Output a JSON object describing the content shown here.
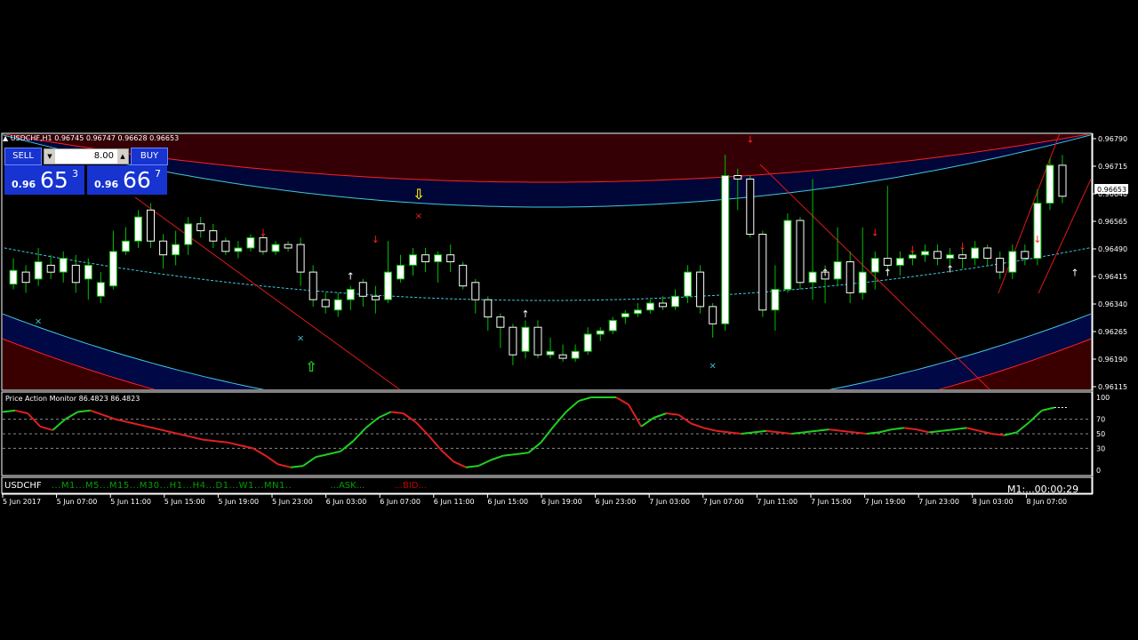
{
  "chart_header": {
    "symbol": "USDCHF,H1",
    "ohlc": "0.96745 0.96747 0.96628 0.96653"
  },
  "trade_panel": {
    "sell_label": "SELL",
    "buy_label": "BUY",
    "lot_value": "8.00",
    "sell_prefix": "0.96",
    "sell_big": "65",
    "sell_sup": "3",
    "buy_prefix": "0.96",
    "buy_big": "66",
    "buy_sup": "7"
  },
  "oscillator": {
    "title": "Price Action Monitor 86.4823 86.4823"
  },
  "bottom_bar": {
    "symbol": "USDCHF",
    "timeframes": "...M1...M5...M15...M30...H1...H4...D1...W1...MN1..",
    "ask": "...ASK...",
    "bid": "...BID...",
    "timer": "M1:...00:00:29"
  },
  "colors": {
    "background": "#000000",
    "up_candle": "#ffffff",
    "wick": "#00c000",
    "band_red": "#ff2020",
    "band_cyan": "#40c8e0",
    "osc_up": "#20d020",
    "osc_down": "#e02020",
    "osc_neutral": "#ffffff"
  },
  "chart_data": [
    {
      "type": "candlestick",
      "title": "USDCHF,H1",
      "ylim": [
        0.9608,
        0.9682
      ],
      "y_ticks": [
        "0.96790",
        "0.96715",
        "0.96640",
        "0.96565",
        "0.96490",
        "0.96415",
        "0.96340",
        "0.96265",
        "0.96190",
        "0.96115"
      ],
      "current_price_label": "0.96653",
      "x_ticks": [
        "5 Jun 2017",
        "5 Jun 07:00",
        "5 Jun 11:00",
        "5 Jun 15:00",
        "5 Jun 19:00",
        "5 Jun 23:00",
        "6 Jun 03:00",
        "6 Jun 07:00",
        "6 Jun 11:00",
        "6 Jun 15:00",
        "6 Jun 19:00",
        "6 Jun 23:00",
        "7 Jun 03:00",
        "7 Jun 07:00",
        "7 Jun 11:00",
        "7 Jun 15:00",
        "7 Jun 19:00",
        "7 Jun 23:00",
        "8 Jun 03:00",
        "8 Jun 07:00"
      ],
      "candles": [
        [
          0.96385,
          0.96425,
          0.9646,
          0.9637
        ],
        [
          0.9642,
          0.9639,
          0.9644,
          0.9636
        ],
        [
          0.964,
          0.9645,
          0.9649,
          0.9638
        ],
        [
          0.9644,
          0.9642,
          0.9647,
          0.964
        ],
        [
          0.9642,
          0.9646,
          0.9648,
          0.9639
        ],
        [
          0.9644,
          0.9639,
          0.9647,
          0.9636
        ],
        [
          0.964,
          0.9644,
          0.9646,
          0.9634
        ],
        [
          0.9635,
          0.9639,
          0.9642,
          0.9633
        ],
        [
          0.9638,
          0.9648,
          0.9654,
          0.9637
        ],
        [
          0.9648,
          0.9651,
          0.9655,
          0.9647
        ],
        [
          0.9651,
          0.9658,
          0.966,
          0.9649
        ],
        [
          0.966,
          0.9651,
          0.9662,
          0.9649
        ],
        [
          0.9651,
          0.9647,
          0.9653,
          0.9643
        ],
        [
          0.9647,
          0.965,
          0.9654,
          0.9644
        ],
        [
          0.965,
          0.9656,
          0.9658,
          0.9647
        ],
        [
          0.9656,
          0.9654,
          0.9658,
          0.9652
        ],
        [
          0.9654,
          0.9651,
          0.9656,
          0.9649
        ],
        [
          0.9651,
          0.9648,
          0.9652,
          0.9647
        ],
        [
          0.9648,
          0.9649,
          0.9651,
          0.9646
        ],
        [
          0.9649,
          0.9652,
          0.9653,
          0.9648
        ],
        [
          0.9652,
          0.9648,
          0.9653,
          0.9647
        ],
        [
          0.9648,
          0.965,
          0.9651,
          0.9647
        ],
        [
          0.965,
          0.9649,
          0.9651,
          0.9648
        ],
        [
          0.965,
          0.9642,
          0.9652,
          0.9638
        ],
        [
          0.9642,
          0.9634,
          0.9644,
          0.9632
        ],
        [
          0.9634,
          0.9632,
          0.9636,
          0.963
        ],
        [
          0.9631,
          0.9634,
          0.9636,
          0.9629
        ],
        [
          0.9634,
          0.9637,
          0.9638,
          0.9631
        ],
        [
          0.9639,
          0.9635,
          0.964,
          0.9632
        ],
        [
          0.9635,
          0.9634,
          0.9638,
          0.963
        ],
        [
          0.9634,
          0.9642,
          0.9651,
          0.9633
        ],
        [
          0.964,
          0.9644,
          0.9647,
          0.9639
        ],
        [
          0.9644,
          0.9647,
          0.9649,
          0.9641
        ],
        [
          0.9647,
          0.9645,
          0.9649,
          0.9642
        ],
        [
          0.9645,
          0.9647,
          0.9648,
          0.9639
        ],
        [
          0.9647,
          0.9645,
          0.965,
          0.9642
        ],
        [
          0.9644,
          0.9638,
          0.9645,
          0.9637
        ],
        [
          0.9639,
          0.9634,
          0.964,
          0.963
        ],
        [
          0.9634,
          0.9629,
          0.9635,
          0.9625
        ],
        [
          0.9629,
          0.9626,
          0.963,
          0.962
        ],
        [
          0.9626,
          0.9618,
          0.9627,
          0.9615
        ],
        [
          0.9619,
          0.9626,
          0.9628,
          0.9617
        ],
        [
          0.9626,
          0.9618,
          0.9628,
          0.9617
        ],
        [
          0.9618,
          0.9619,
          0.9623,
          0.9617
        ],
        [
          0.9618,
          0.9617,
          0.9621,
          0.9616
        ],
        [
          0.9617,
          0.9619,
          0.9621,
          0.9616
        ],
        [
          0.9619,
          0.9624,
          0.9626,
          0.9618
        ],
        [
          0.9624,
          0.9625,
          0.9626,
          0.9622
        ],
        [
          0.9625,
          0.9628,
          0.9629,
          0.9624
        ],
        [
          0.9629,
          0.963,
          0.9631,
          0.9627
        ],
        [
          0.963,
          0.9631,
          0.9633,
          0.9629
        ],
        [
          0.9631,
          0.9633,
          0.9634,
          0.963
        ],
        [
          0.9633,
          0.9632,
          0.9635,
          0.9631
        ],
        [
          0.9632,
          0.9635,
          0.9637,
          0.9631
        ],
        [
          0.9635,
          0.9642,
          0.9644,
          0.9633
        ],
        [
          0.9642,
          0.9632,
          0.9644,
          0.963
        ],
        [
          0.9632,
          0.9627,
          0.9633,
          0.9623
        ],
        [
          0.9627,
          0.967,
          0.9676,
          0.9625
        ],
        [
          0.967,
          0.9669,
          0.9672,
          0.966
        ],
        [
          0.9669,
          0.9653,
          0.967,
          0.9652
        ],
        [
          0.9653,
          0.9631,
          0.9654,
          0.9629
        ],
        [
          0.9631,
          0.9637,
          0.9644,
          0.9625
        ],
        [
          0.9637,
          0.9657,
          0.9659,
          0.9636
        ],
        [
          0.9657,
          0.9639,
          0.9658,
          0.9637
        ],
        [
          0.9639,
          0.9642,
          0.9669,
          0.9634
        ],
        [
          0.9642,
          0.964,
          0.9644,
          0.9633
        ],
        [
          0.964,
          0.9645,
          0.9655,
          0.9638
        ],
        [
          0.9645,
          0.9636,
          0.9648,
          0.9633
        ],
        [
          0.9636,
          0.9642,
          0.9655,
          0.9634
        ],
        [
          0.9642,
          0.9646,
          0.9648,
          0.9637
        ],
        [
          0.9646,
          0.9644,
          0.9667,
          0.9642
        ],
        [
          0.9644,
          0.9646,
          0.9648,
          0.9641
        ],
        [
          0.9646,
          0.9647,
          0.9648,
          0.9644
        ],
        [
          0.9647,
          0.9648,
          0.965,
          0.9645
        ],
        [
          0.9648,
          0.9646,
          0.965,
          0.9644
        ],
        [
          0.9646,
          0.9647,
          0.9649,
          0.9644
        ],
        [
          0.9647,
          0.9646,
          0.9649,
          0.9643
        ],
        [
          0.9646,
          0.9649,
          0.9651,
          0.9644
        ],
        [
          0.9649,
          0.9646,
          0.965,
          0.9644
        ],
        [
          0.9646,
          0.9642,
          0.9648,
          0.964
        ],
        [
          0.9642,
          0.9648,
          0.965,
          0.964
        ],
        [
          0.9648,
          0.9646,
          0.965,
          0.9644
        ],
        [
          0.9646,
          0.9662,
          0.9666,
          0.9644
        ],
        [
          0.9662,
          0.9673,
          0.9675,
          0.966
        ],
        [
          0.9673,
          0.9664,
          0.9676,
          0.9662
        ]
      ],
      "indicators": [
        {
          "name": "arrows_up_white",
          "points": [
            [
              27,
              0.9643
            ],
            [
              41,
              0.9632
            ],
            [
              65,
              0.9644
            ],
            [
              70,
              0.9644
            ],
            [
              75,
              0.9645
            ],
            [
              80,
              0.9646
            ],
            [
              85,
              0.9644
            ],
            [
              88,
              0.9642
            ]
          ]
        },
        {
          "name": "arrows_down_red",
          "points": [
            [
              20,
              0.9652
            ],
            [
              29,
              0.965
            ],
            [
              59,
              0.9679
            ],
            [
              69,
              0.9652
            ],
            [
              72,
              0.9647
            ],
            [
              76,
              0.9648
            ],
            [
              82,
              0.965
            ]
          ]
        }
      ]
    },
    {
      "type": "line",
      "title": "Price Action Monitor 86.4823 86.4823",
      "ylim": [
        0,
        100
      ],
      "y_ticks": [
        "100",
        "70",
        "50",
        "30",
        "0"
      ],
      "levels": [
        70,
        50,
        30
      ],
      "series": [
        {
          "name": "Price Action Monitor",
          "values": [
            80,
            82,
            78,
            60,
            55,
            70,
            80,
            82,
            76,
            70,
            66,
            62,
            58,
            54,
            50,
            46,
            42,
            40,
            38,
            34,
            30,
            20,
            8,
            4,
            6,
            18,
            22,
            26,
            40,
            58,
            72,
            80,
            78,
            66,
            48,
            28,
            12,
            4,
            6,
            14,
            20,
            22,
            24,
            38,
            60,
            80,
            95,
            100,
            102,
            104,
            90,
            60,
            72,
            78,
            76,
            64,
            58,
            54,
            52,
            50,
            52,
            54,
            52,
            50,
            52,
            54,
            56,
            54,
            52,
            50,
            52,
            56,
            58,
            56,
            52,
            54,
            56,
            58,
            54,
            50,
            48,
            52,
            66,
            82,
            86,
            86
          ]
        }
      ]
    }
  ]
}
